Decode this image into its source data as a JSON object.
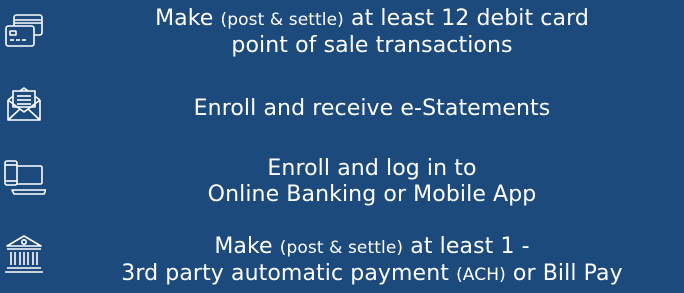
{
  "requirements": [
    {
      "icon": "credit-card-icon",
      "line1_a": "Make ",
      "line1_small": "(post & settle)",
      "line1_b": " at least 12 debit card",
      "line2": "point of sale transactions"
    },
    {
      "icon": "envelope-icon",
      "line1": "Enroll and receive e-Statements"
    },
    {
      "icon": "laptop-phone-icon",
      "line1": "Enroll and log in to",
      "line2": "Online Banking or Mobile App"
    },
    {
      "icon": "bank-building-icon",
      "line1_a": "Make ",
      "line1_small": "(post & settle)",
      "line1_b": " at least 1 -",
      "line2_a": "3rd party automatic payment ",
      "line2_small": "(ACH)",
      "line2_b": " or Bill Pay"
    }
  ],
  "colors": {
    "background": "#1c4a7c",
    "text": "#ffffff"
  }
}
